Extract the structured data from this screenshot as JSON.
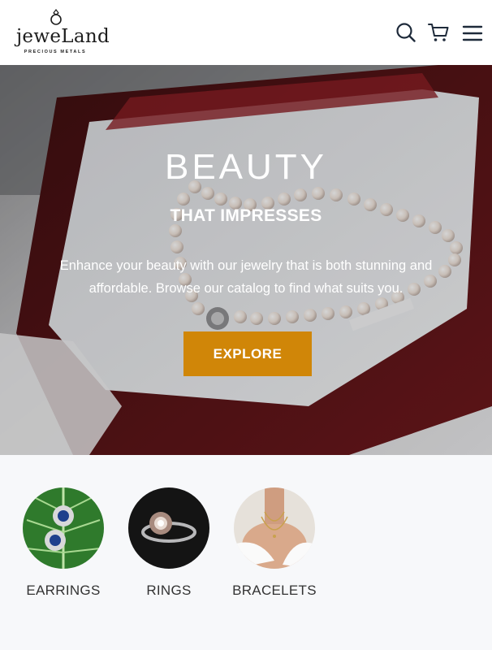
{
  "brand": {
    "name": "jeweLand",
    "tagline": "PRECIOUS METALS"
  },
  "header": {
    "icons": [
      "search-icon",
      "cart-icon",
      "menu-icon"
    ]
  },
  "hero": {
    "title": "BEAUTY",
    "subtitle": "THAT IMPRESSES",
    "description": "Enhance your beauty with our jewelry that is both stunning and affordable. Browse our catalog to find what suits you.",
    "cta_label": "EXPLORE"
  },
  "categories": [
    {
      "label": "EARRINGS"
    },
    {
      "label": "RINGS"
    },
    {
      "label": "BRACELETS"
    }
  ],
  "colors": {
    "accent": "#d08608",
    "header_bg": "#ffffff",
    "page_bg": "#f7f8fa",
    "icon": "#1e2a3a"
  }
}
